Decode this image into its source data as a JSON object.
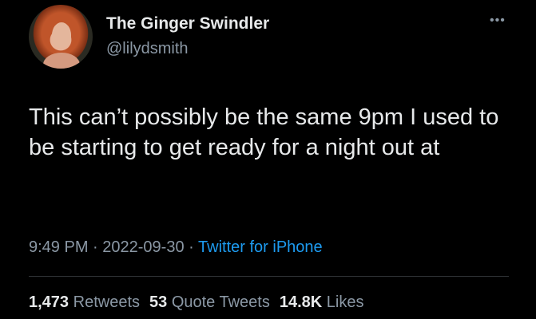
{
  "user": {
    "display_name": "The Ginger Swindler",
    "handle": "@lilydsmith"
  },
  "more_icon": "more-horizontal-icon",
  "tweet": {
    "text": "This can’t possibly be the same 9pm I used to be starting to get ready for a night out at",
    "time": "9:49 PM",
    "separator": "·",
    "date": "2022-09-30",
    "source": "Twitter for iPhone"
  },
  "stats": {
    "retweets_count": "1,473",
    "retweets_label": "Retweets",
    "quotes_count": "53",
    "quotes_label": "Quote Tweets",
    "likes_count": "14.8K",
    "likes_label": "Likes"
  },
  "colors": {
    "background": "#000000",
    "text": "#e7e9ea",
    "muted": "#8b98a5",
    "link": "#1d9bf0"
  }
}
